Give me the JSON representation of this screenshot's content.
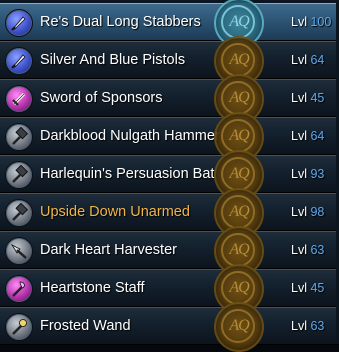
{
  "level_prefix": "Lvl",
  "medal_text": "AQ",
  "colors": {
    "level_number": "#5fa8ea",
    "highlight_name": "#f0b546",
    "selected_row": "#2e5778"
  },
  "items": [
    {
      "name": "Re's Dual Long Stabbers",
      "level": "100",
      "icon": "dagger-icon",
      "icon_color": "blue"
    },
    {
      "name": "Silver And Blue Pistols",
      "level": "64",
      "icon": "dagger-icon",
      "icon_color": "blue"
    },
    {
      "name": "Sword of Sponsors",
      "level": "45",
      "icon": "sword-icon",
      "icon_color": "purple"
    },
    {
      "name": "Darkblood Nulgath Hammer",
      "level": "64",
      "icon": "hammer-icon",
      "icon_color": "grey"
    },
    {
      "name": "Harlequin's Persuasion Bat",
      "level": "93",
      "icon": "hammer-icon",
      "icon_color": "grey"
    },
    {
      "name": "Upside Down Unarmed",
      "level": "98",
      "icon": "hammer-icon",
      "icon_color": "grey"
    },
    {
      "name": "Dark Heart Harvester",
      "level": "63",
      "icon": "axe-icon",
      "icon_color": "grey"
    },
    {
      "name": "Heartstone Staff",
      "level": "45",
      "icon": "staff-icon",
      "icon_color": "purple"
    },
    {
      "name": "Frosted Wand",
      "level": "63",
      "icon": "wand-icon",
      "icon_color": "grey"
    }
  ]
}
